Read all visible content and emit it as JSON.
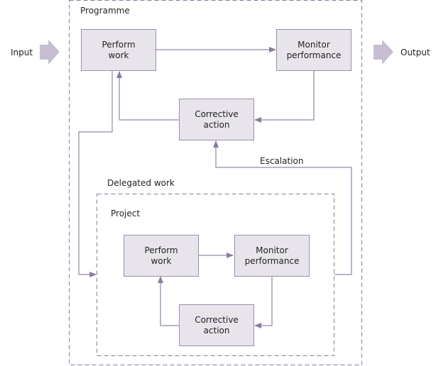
{
  "io": {
    "input": "Input",
    "output": "Output"
  },
  "programme": {
    "title": "Programme",
    "perform": {
      "line1": "Perform",
      "line2": "work"
    },
    "monitor": {
      "line1": "Monitor",
      "line2": "performance"
    },
    "corrective": {
      "line1": "Corrective",
      "line2": "action"
    }
  },
  "escalation": "Escalation",
  "delegated": "Delegated work",
  "project": {
    "title": "Project",
    "perform": {
      "line1": "Perform",
      "line2": "work"
    },
    "monitor": {
      "line1": "Monitor",
      "line2": "performance"
    },
    "corrective": {
      "line1": "Corrective",
      "line2": "action"
    }
  },
  "colors": {
    "line": "#a89cb8",
    "box_fill": "#e8e4ec",
    "box_border": "#9a8fa8",
    "big_arrow": "#c6bdd0"
  }
}
